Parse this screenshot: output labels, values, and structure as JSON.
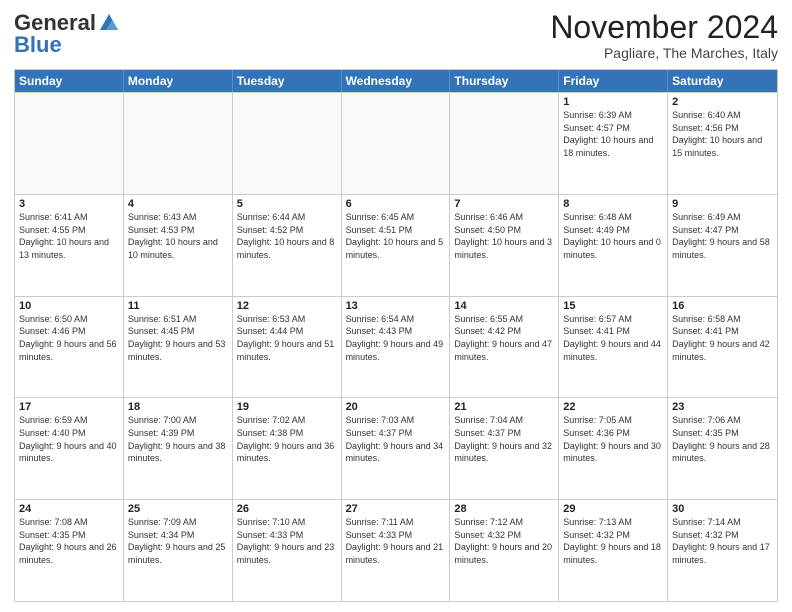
{
  "logo": {
    "general": "General",
    "blue": "Blue"
  },
  "title": "November 2024",
  "subtitle": "Pagliare, The Marches, Italy",
  "headers": [
    "Sunday",
    "Monday",
    "Tuesday",
    "Wednesday",
    "Thursday",
    "Friday",
    "Saturday"
  ],
  "weeks": [
    [
      {
        "day": "",
        "info": ""
      },
      {
        "day": "",
        "info": ""
      },
      {
        "day": "",
        "info": ""
      },
      {
        "day": "",
        "info": ""
      },
      {
        "day": "",
        "info": ""
      },
      {
        "day": "1",
        "info": "Sunrise: 6:39 AM\nSunset: 4:57 PM\nDaylight: 10 hours and 18 minutes."
      },
      {
        "day": "2",
        "info": "Sunrise: 6:40 AM\nSunset: 4:56 PM\nDaylight: 10 hours and 15 minutes."
      }
    ],
    [
      {
        "day": "3",
        "info": "Sunrise: 6:41 AM\nSunset: 4:55 PM\nDaylight: 10 hours and 13 minutes."
      },
      {
        "day": "4",
        "info": "Sunrise: 6:43 AM\nSunset: 4:53 PM\nDaylight: 10 hours and 10 minutes."
      },
      {
        "day": "5",
        "info": "Sunrise: 6:44 AM\nSunset: 4:52 PM\nDaylight: 10 hours and 8 minutes."
      },
      {
        "day": "6",
        "info": "Sunrise: 6:45 AM\nSunset: 4:51 PM\nDaylight: 10 hours and 5 minutes."
      },
      {
        "day": "7",
        "info": "Sunrise: 6:46 AM\nSunset: 4:50 PM\nDaylight: 10 hours and 3 minutes."
      },
      {
        "day": "8",
        "info": "Sunrise: 6:48 AM\nSunset: 4:49 PM\nDaylight: 10 hours and 0 minutes."
      },
      {
        "day": "9",
        "info": "Sunrise: 6:49 AM\nSunset: 4:47 PM\nDaylight: 9 hours and 58 minutes."
      }
    ],
    [
      {
        "day": "10",
        "info": "Sunrise: 6:50 AM\nSunset: 4:46 PM\nDaylight: 9 hours and 56 minutes."
      },
      {
        "day": "11",
        "info": "Sunrise: 6:51 AM\nSunset: 4:45 PM\nDaylight: 9 hours and 53 minutes."
      },
      {
        "day": "12",
        "info": "Sunrise: 6:53 AM\nSunset: 4:44 PM\nDaylight: 9 hours and 51 minutes."
      },
      {
        "day": "13",
        "info": "Sunrise: 6:54 AM\nSunset: 4:43 PM\nDaylight: 9 hours and 49 minutes."
      },
      {
        "day": "14",
        "info": "Sunrise: 6:55 AM\nSunset: 4:42 PM\nDaylight: 9 hours and 47 minutes."
      },
      {
        "day": "15",
        "info": "Sunrise: 6:57 AM\nSunset: 4:41 PM\nDaylight: 9 hours and 44 minutes."
      },
      {
        "day": "16",
        "info": "Sunrise: 6:58 AM\nSunset: 4:41 PM\nDaylight: 9 hours and 42 minutes."
      }
    ],
    [
      {
        "day": "17",
        "info": "Sunrise: 6:59 AM\nSunset: 4:40 PM\nDaylight: 9 hours and 40 minutes."
      },
      {
        "day": "18",
        "info": "Sunrise: 7:00 AM\nSunset: 4:39 PM\nDaylight: 9 hours and 38 minutes."
      },
      {
        "day": "19",
        "info": "Sunrise: 7:02 AM\nSunset: 4:38 PM\nDaylight: 9 hours and 36 minutes."
      },
      {
        "day": "20",
        "info": "Sunrise: 7:03 AM\nSunset: 4:37 PM\nDaylight: 9 hours and 34 minutes."
      },
      {
        "day": "21",
        "info": "Sunrise: 7:04 AM\nSunset: 4:37 PM\nDaylight: 9 hours and 32 minutes."
      },
      {
        "day": "22",
        "info": "Sunrise: 7:05 AM\nSunset: 4:36 PM\nDaylight: 9 hours and 30 minutes."
      },
      {
        "day": "23",
        "info": "Sunrise: 7:06 AM\nSunset: 4:35 PM\nDaylight: 9 hours and 28 minutes."
      }
    ],
    [
      {
        "day": "24",
        "info": "Sunrise: 7:08 AM\nSunset: 4:35 PM\nDaylight: 9 hours and 26 minutes."
      },
      {
        "day": "25",
        "info": "Sunrise: 7:09 AM\nSunset: 4:34 PM\nDaylight: 9 hours and 25 minutes."
      },
      {
        "day": "26",
        "info": "Sunrise: 7:10 AM\nSunset: 4:33 PM\nDaylight: 9 hours and 23 minutes."
      },
      {
        "day": "27",
        "info": "Sunrise: 7:11 AM\nSunset: 4:33 PM\nDaylight: 9 hours and 21 minutes."
      },
      {
        "day": "28",
        "info": "Sunrise: 7:12 AM\nSunset: 4:32 PM\nDaylight: 9 hours and 20 minutes."
      },
      {
        "day": "29",
        "info": "Sunrise: 7:13 AM\nSunset: 4:32 PM\nDaylight: 9 hours and 18 minutes."
      },
      {
        "day": "30",
        "info": "Sunrise: 7:14 AM\nSunset: 4:32 PM\nDaylight: 9 hours and 17 minutes."
      }
    ]
  ]
}
